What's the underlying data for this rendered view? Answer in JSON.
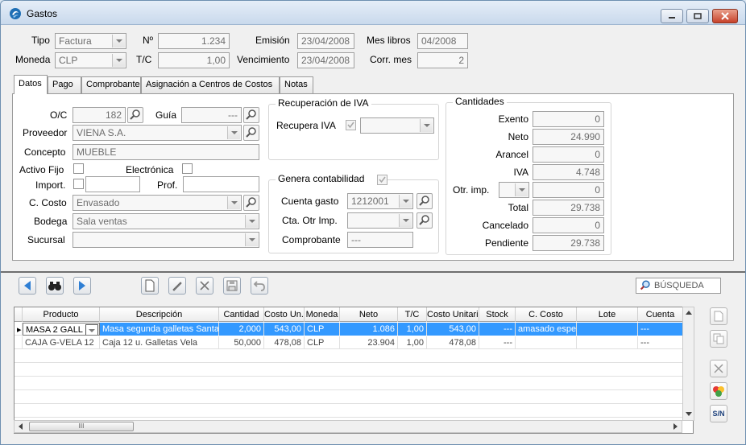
{
  "window": {
    "title": "Gastos"
  },
  "header": {
    "tipo_label": "Tipo",
    "tipo_value": "Factura",
    "numero_label": "Nº",
    "numero_value": "1.234",
    "emision_label": "Emisión",
    "emision_value": "23/04/2008",
    "mes_libros_label": "Mes libros",
    "mes_libros_value": "04/2008",
    "moneda_label": "Moneda",
    "moneda_value": "CLP",
    "tc_label": "T/C",
    "tc_value": "1,00",
    "vencimiento_label": "Vencimiento",
    "vencimiento_value": "23/04/2008",
    "corr_mes_label": "Corr. mes",
    "corr_mes_value": "2"
  },
  "tabs": [
    "Datos",
    "Pago",
    "Comprobante",
    "Asignación a Centros de Costos",
    "Notas"
  ],
  "datos": {
    "oc_label": "O/C",
    "oc_value": "182",
    "guia_label": "Guía",
    "guia_value": "---",
    "proveedor_label": "Proveedor",
    "proveedor_value": "VIENA S.A.",
    "concepto_label": "Concepto",
    "concepto_value": "MUEBLE",
    "activo_fijo_label": "Activo Fijo",
    "electronica_label": "Electrónica",
    "import_label": "Import.",
    "prof_label": "Prof.",
    "c_costo_label": "C. Costo",
    "c_costo_value": "Envasado",
    "bodega_label": "Bodega",
    "bodega_value": "Sala ventas",
    "sucursal_label": "Sucursal",
    "sucursal_value": ""
  },
  "iva": {
    "group_title": "Recuperación de IVA",
    "recupera_label": "Recupera IVA"
  },
  "contab": {
    "group_title": "Genera contabilidad",
    "cuenta_gasto_label": "Cuenta gasto",
    "cuenta_gasto_value": "1212001",
    "cta_otr_label": "Cta. Otr Imp.",
    "cta_otr_value": "",
    "comprobante_label": "Comprobante",
    "comprobante_value": "---"
  },
  "cantidades": {
    "group_title": "Cantidades",
    "exento_label": "Exento",
    "exento_value": "0",
    "neto_label": "Neto",
    "neto_value": "24.990",
    "arancel_label": "Arancel",
    "arancel_value": "0",
    "iva_label": "IVA",
    "iva_value": "4.748",
    "otr_imp_label": "Otr. imp.",
    "otr_imp_value": "0",
    "total_label": "Total",
    "total_value": "29.738",
    "cancelado_label": "Cancelado",
    "cancelado_value": "0",
    "pendiente_label": "Pendiente",
    "pendiente_value": "29.738"
  },
  "toolbar": {
    "search_label": "BÚSQUEDA"
  },
  "grid": {
    "columns": [
      "Producto",
      "Descripción",
      "Cantidad",
      "Costo Un.",
      "Moneda",
      "Neto",
      "T/C",
      "Costo Unitario",
      "Stock",
      "C. Costo",
      "Lote",
      "Cuenta"
    ],
    "rows": [
      [
        "MASA 2 GALL",
        "Masa segunda galletas Santa",
        "2,000",
        "543,00",
        "CLP",
        "1.086",
        "1,00",
        "543,00",
        "---",
        "amasado espe",
        "",
        "---"
      ],
      [
        "CAJA G-VELA 12",
        "Caja 12 u. Galletas Vela",
        "50,000",
        "478,08",
        "CLP",
        "23.904",
        "1,00",
        "478,08",
        "---",
        "",
        "",
        "---"
      ]
    ],
    "hscroll_grip": "III"
  },
  "side_buttons": {
    "sn_label": "S/N"
  },
  "colors": {
    "selection": "#3399ff",
    "titlebar": "#c9d9ec",
    "nav_blue": "#2f7fd4"
  }
}
